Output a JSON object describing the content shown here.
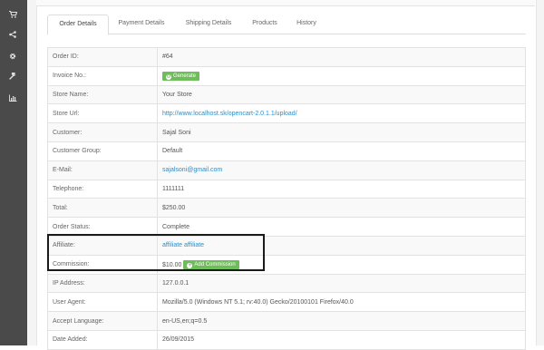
{
  "sidebar": {
    "items": [
      {
        "icon": "cart-icon"
      },
      {
        "icon": "share-icon"
      },
      {
        "icon": "gear-icon"
      },
      {
        "icon": "wrench-icon"
      },
      {
        "icon": "bar-chart-icon"
      }
    ]
  },
  "tabs": [
    {
      "label": "Order Details",
      "active": true
    },
    {
      "label": "Payment Details",
      "active": false
    },
    {
      "label": "Shipping Details",
      "active": false
    },
    {
      "label": "Products",
      "active": false
    },
    {
      "label": "History",
      "active": false
    }
  ],
  "details": {
    "order_id": {
      "label": "Order ID:",
      "value": "#64"
    },
    "invoice": {
      "label": "Invoice No.:",
      "button": "Generate"
    },
    "store_name": {
      "label": "Store Name:",
      "value": "Your Store"
    },
    "store_url": {
      "label": "Store Url:",
      "value": "http://www.localhost.sk/opencart-2.0.1.1/upload/"
    },
    "customer": {
      "label": "Customer:",
      "value": "Sajal Soni"
    },
    "customer_group": {
      "label": "Customer Group:",
      "value": "Default"
    },
    "email": {
      "label": "E-Mail:",
      "value": "sajalsoni@gmail.com"
    },
    "telephone": {
      "label": "Telephone:",
      "value": "1111111"
    },
    "total": {
      "label": "Total:",
      "value": "$250.00"
    },
    "order_status": {
      "label": "Order Status:",
      "value": "Complete"
    },
    "affiliate": {
      "label": "Affiliate:",
      "value": "affiliate affiliate"
    },
    "commission": {
      "label": "Commission:",
      "value": "$10.00",
      "button": "Add Commission"
    },
    "ip_address": {
      "label": "IP Address:",
      "value": "127.0.0.1"
    },
    "user_agent": {
      "label": "User Agent:",
      "value": "Mozilla/5.0 (Windows NT 5.1; rv:40.0) Gecko/20100101 Firefox/40.0"
    },
    "accept_language": {
      "label": "Accept Language:",
      "value": "en-US,en;q=0.5"
    },
    "date_added": {
      "label": "Date Added:",
      "value": "26/09/2015"
    }
  },
  "colors": {
    "sidebar": "#4a4a4a",
    "link": "#2a8ec9",
    "button_green": "#6fbd5a",
    "highlight_border": "#1a1a1a"
  }
}
